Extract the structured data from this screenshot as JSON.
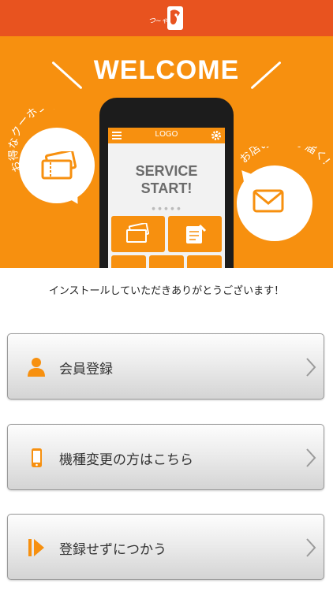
{
  "colors": {
    "header": "#e8531f",
    "hero_background": "#f7900f",
    "accent": "#f7900f"
  },
  "header": {
    "logo_icon": "calligraphy-face-logo"
  },
  "hero": {
    "title": "WELCOME",
    "coupon_bubble": {
      "text": "お得なクーポンや",
      "icon": "ticket-icon"
    },
    "info_bubble": {
      "text": "お店の情報が届く!",
      "icon": "envelope-icon"
    },
    "phone": {
      "app_logo": "LOGO",
      "headline_line1": "SERVICE",
      "headline_line2": "START!",
      "menu_icon": "hamburger-menu-icon",
      "settings_icon": "gear-icon",
      "tiles": [
        "ticket-icon",
        "notebook-icon"
      ]
    }
  },
  "thanks_message": "インストールしていただきありがとうございます！",
  "buttons": [
    {
      "label": "会員登録",
      "icon": "person-icon"
    },
    {
      "label": "機種変更の方はこちら",
      "icon": "smartphone-icon"
    },
    {
      "label": "登録せずにつかう",
      "icon": "play-skip-icon"
    }
  ]
}
